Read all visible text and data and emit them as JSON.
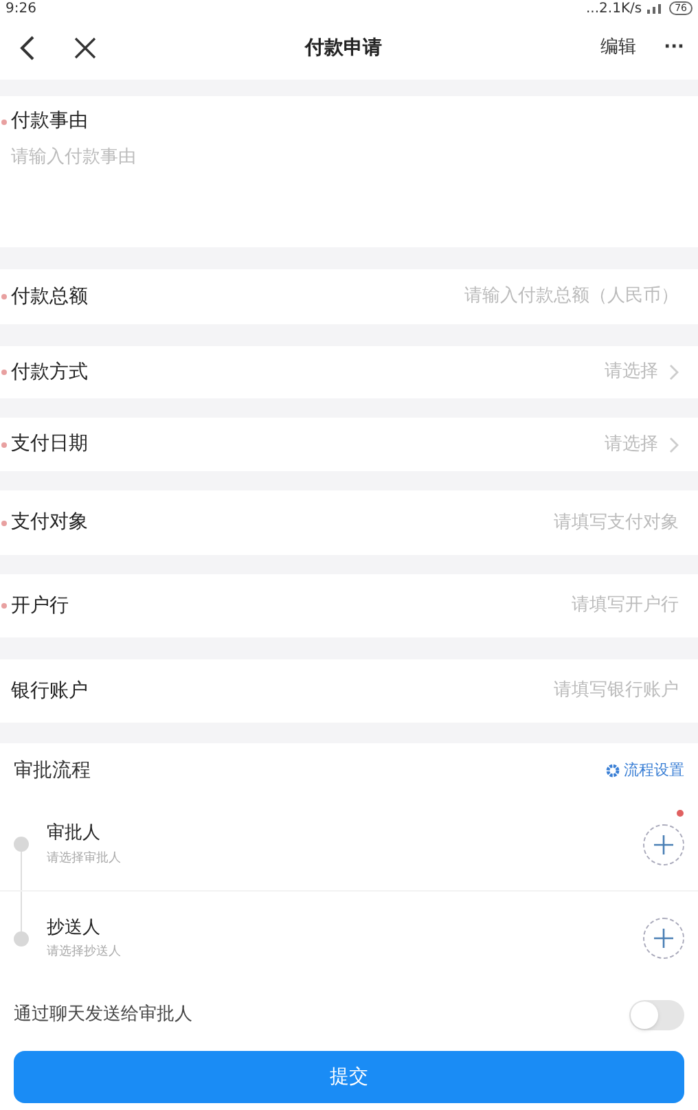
{
  "status_bar": {
    "time": "9:26",
    "network": "...2.1K/s",
    "battery": "76"
  },
  "nav": {
    "title": "付款申请",
    "edit": "编辑",
    "more": "···"
  },
  "reason": {
    "label": "付款事由",
    "required": true,
    "placeholder": "请输入付款事由"
  },
  "fields": [
    {
      "kind": "input",
      "label": "付款总额",
      "required": true,
      "placeholder": "请输入付款总额（人民币）"
    },
    {
      "kind": "select",
      "label": "付款方式",
      "required": true,
      "placeholder": "请选择"
    },
    {
      "kind": "select",
      "label": "支付日期",
      "required": true,
      "placeholder": "请选择"
    },
    {
      "kind": "input",
      "label": "支付对象",
      "required": true,
      "placeholder": "请填写支付对象"
    },
    {
      "kind": "input",
      "label": "开户行",
      "required": true,
      "placeholder": "请填写开户行"
    },
    {
      "kind": "input",
      "label": "银行账户",
      "required": false,
      "placeholder": "请填写银行账户"
    }
  ],
  "approval": {
    "title": "审批流程",
    "settings": "流程设置",
    "steps": [
      {
        "title": "审批人",
        "hint": "请选择审批人",
        "required": true
      },
      {
        "title": "抄送人",
        "hint": "请选择抄送人",
        "required": false
      }
    ]
  },
  "chat_toggle": {
    "label": "通过聊天发送给审批人",
    "on": false
  },
  "submit": "提交"
}
